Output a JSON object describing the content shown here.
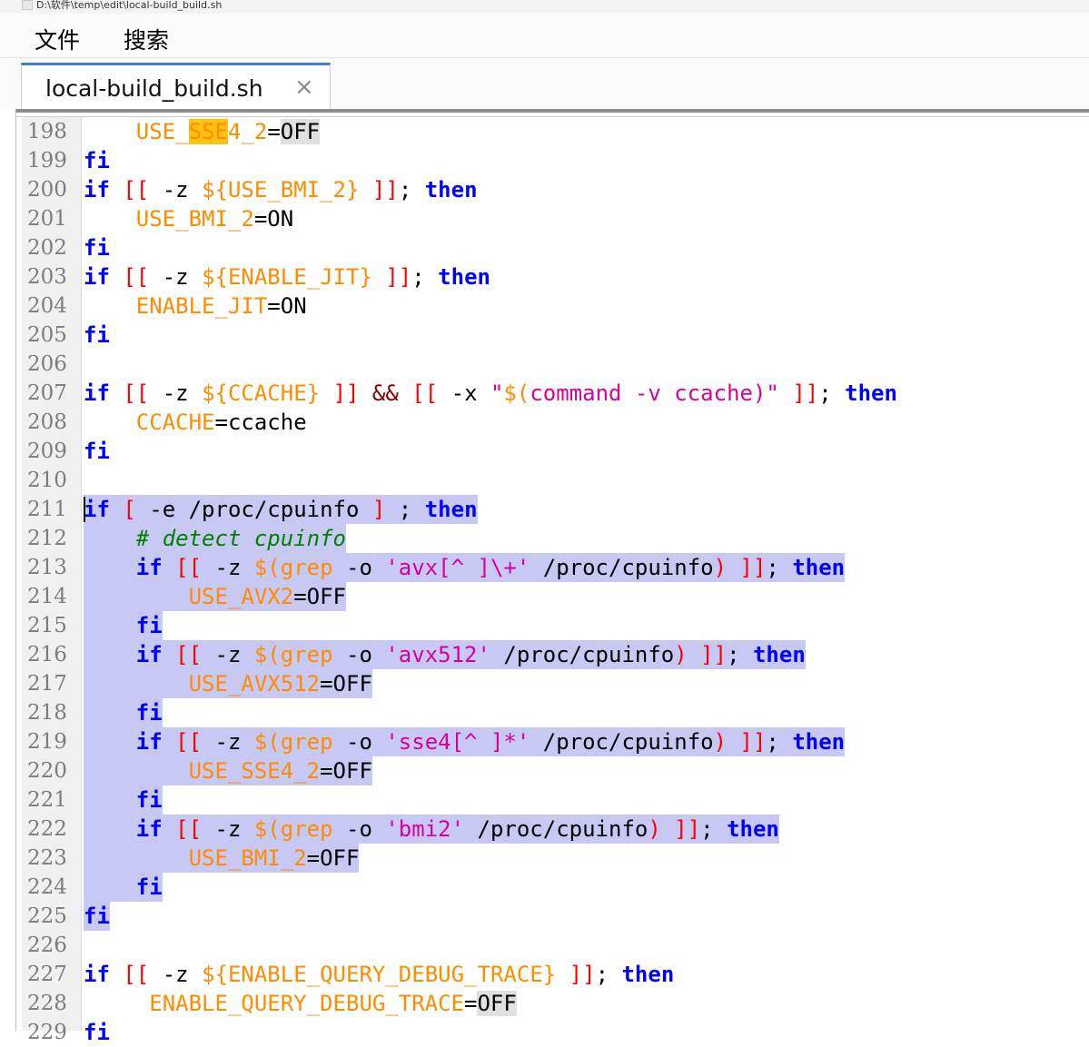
{
  "window": {
    "title": "D:\\软件\\temp\\edit\\local-build_build.sh"
  },
  "menu": {
    "items": [
      "文件",
      "搜索"
    ]
  },
  "tabs": [
    {
      "label": "local-build_build.sh",
      "close": "×"
    }
  ],
  "editor": {
    "language": "shell",
    "selection": {
      "from_line": 211,
      "to_line": 225
    },
    "caret_line": 211,
    "colors": {
      "keyword": "#0000ff",
      "bracket": "#ff0000",
      "variable": "#ff8c00",
      "string": "#d6009e",
      "comment": "#008000",
      "operator": "#800000",
      "selection": "#c8c8f4",
      "search_match": "#ffc20e",
      "line_number": "#7d7d7d"
    },
    "lines": [
      {
        "n": "198",
        "text": "    USE_SSE4_2=OFF"
      },
      {
        "n": "199",
        "text": "fi"
      },
      {
        "n": "200",
        "text": "if [[ -z ${USE_BMI_2} ]]; then"
      },
      {
        "n": "201",
        "text": "    USE_BMI_2=ON"
      },
      {
        "n": "202",
        "text": "fi"
      },
      {
        "n": "203",
        "text": "if [[ -z ${ENABLE_JIT} ]]; then"
      },
      {
        "n": "204",
        "text": "    ENABLE_JIT=ON"
      },
      {
        "n": "205",
        "text": "fi"
      },
      {
        "n": "206",
        "text": ""
      },
      {
        "n": "207",
        "text": "if [[ -z ${CCACHE} ]] && [[ -x \"$(command -v ccache)\" ]]; then"
      },
      {
        "n": "208",
        "text": "    CCACHE=ccache"
      },
      {
        "n": "209",
        "text": "fi"
      },
      {
        "n": "210",
        "text": ""
      },
      {
        "n": "211",
        "text": "if [ -e /proc/cpuinfo ] ; then"
      },
      {
        "n": "212",
        "text": "    # detect cpuinfo"
      },
      {
        "n": "213",
        "text": "    if [[ -z $(grep -o 'avx[^ ]\\+' /proc/cpuinfo) ]]; then"
      },
      {
        "n": "214",
        "text": "        USE_AVX2=OFF"
      },
      {
        "n": "215",
        "text": "    fi"
      },
      {
        "n": "216",
        "text": "    if [[ -z $(grep -o 'avx512' /proc/cpuinfo) ]]; then"
      },
      {
        "n": "217",
        "text": "        USE_AVX512=OFF"
      },
      {
        "n": "218",
        "text": "    fi"
      },
      {
        "n": "219",
        "text": "    if [[ -z $(grep -o 'sse4[^ ]*' /proc/cpuinfo) ]]; then"
      },
      {
        "n": "220",
        "text": "        USE_SSE4_2=OFF"
      },
      {
        "n": "221",
        "text": "    fi"
      },
      {
        "n": "222",
        "text": "    if [[ -z $(grep -o 'bmi2' /proc/cpuinfo) ]]; then"
      },
      {
        "n": "223",
        "text": "        USE_BMI_2=OFF"
      },
      {
        "n": "224",
        "text": "    fi"
      },
      {
        "n": "225",
        "text": "fi"
      },
      {
        "n": "226",
        "text": ""
      },
      {
        "n": "227",
        "text": "if [[ -z ${ENABLE_QUERY_DEBUG_TRACE} ]]; then"
      },
      {
        "n": "228",
        "text": "     ENABLE_QUERY_DEBUG_TRACE=OFF"
      },
      {
        "n": "229",
        "text": "fi"
      }
    ]
  }
}
